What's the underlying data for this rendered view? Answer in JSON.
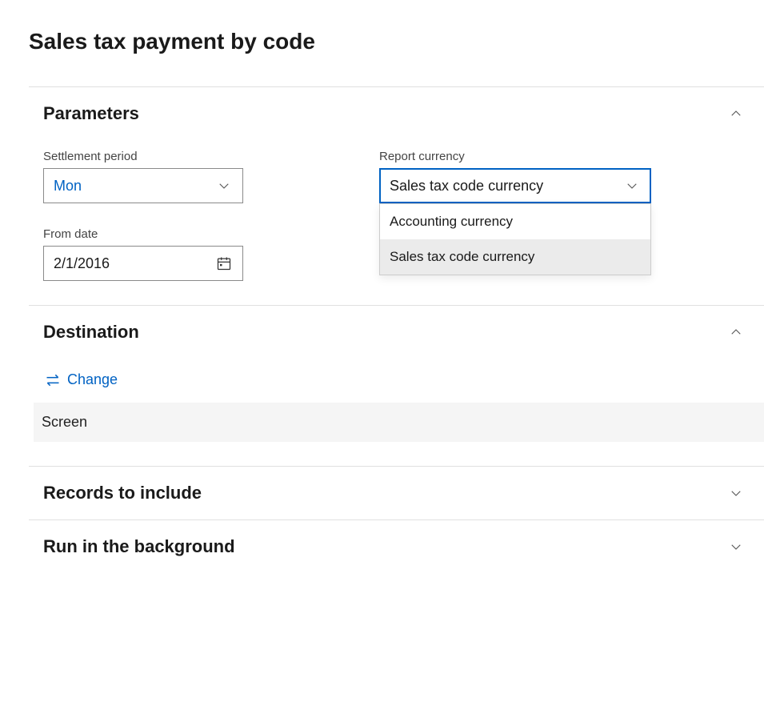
{
  "page_title": "Sales tax payment by code",
  "sections": {
    "parameters": {
      "title": "Parameters",
      "settlement_period": {
        "label": "Settlement period",
        "value": "Mon"
      },
      "from_date": {
        "label": "From date",
        "value": "2/1/2016"
      },
      "report_currency": {
        "label": "Report currency",
        "value": "Sales tax code currency",
        "options": [
          "Accounting currency",
          "Sales tax code currency"
        ]
      }
    },
    "destination": {
      "title": "Destination",
      "change_label": "Change",
      "value": "Screen"
    },
    "records": {
      "title": "Records to include"
    },
    "background": {
      "title": "Run in the background"
    }
  }
}
